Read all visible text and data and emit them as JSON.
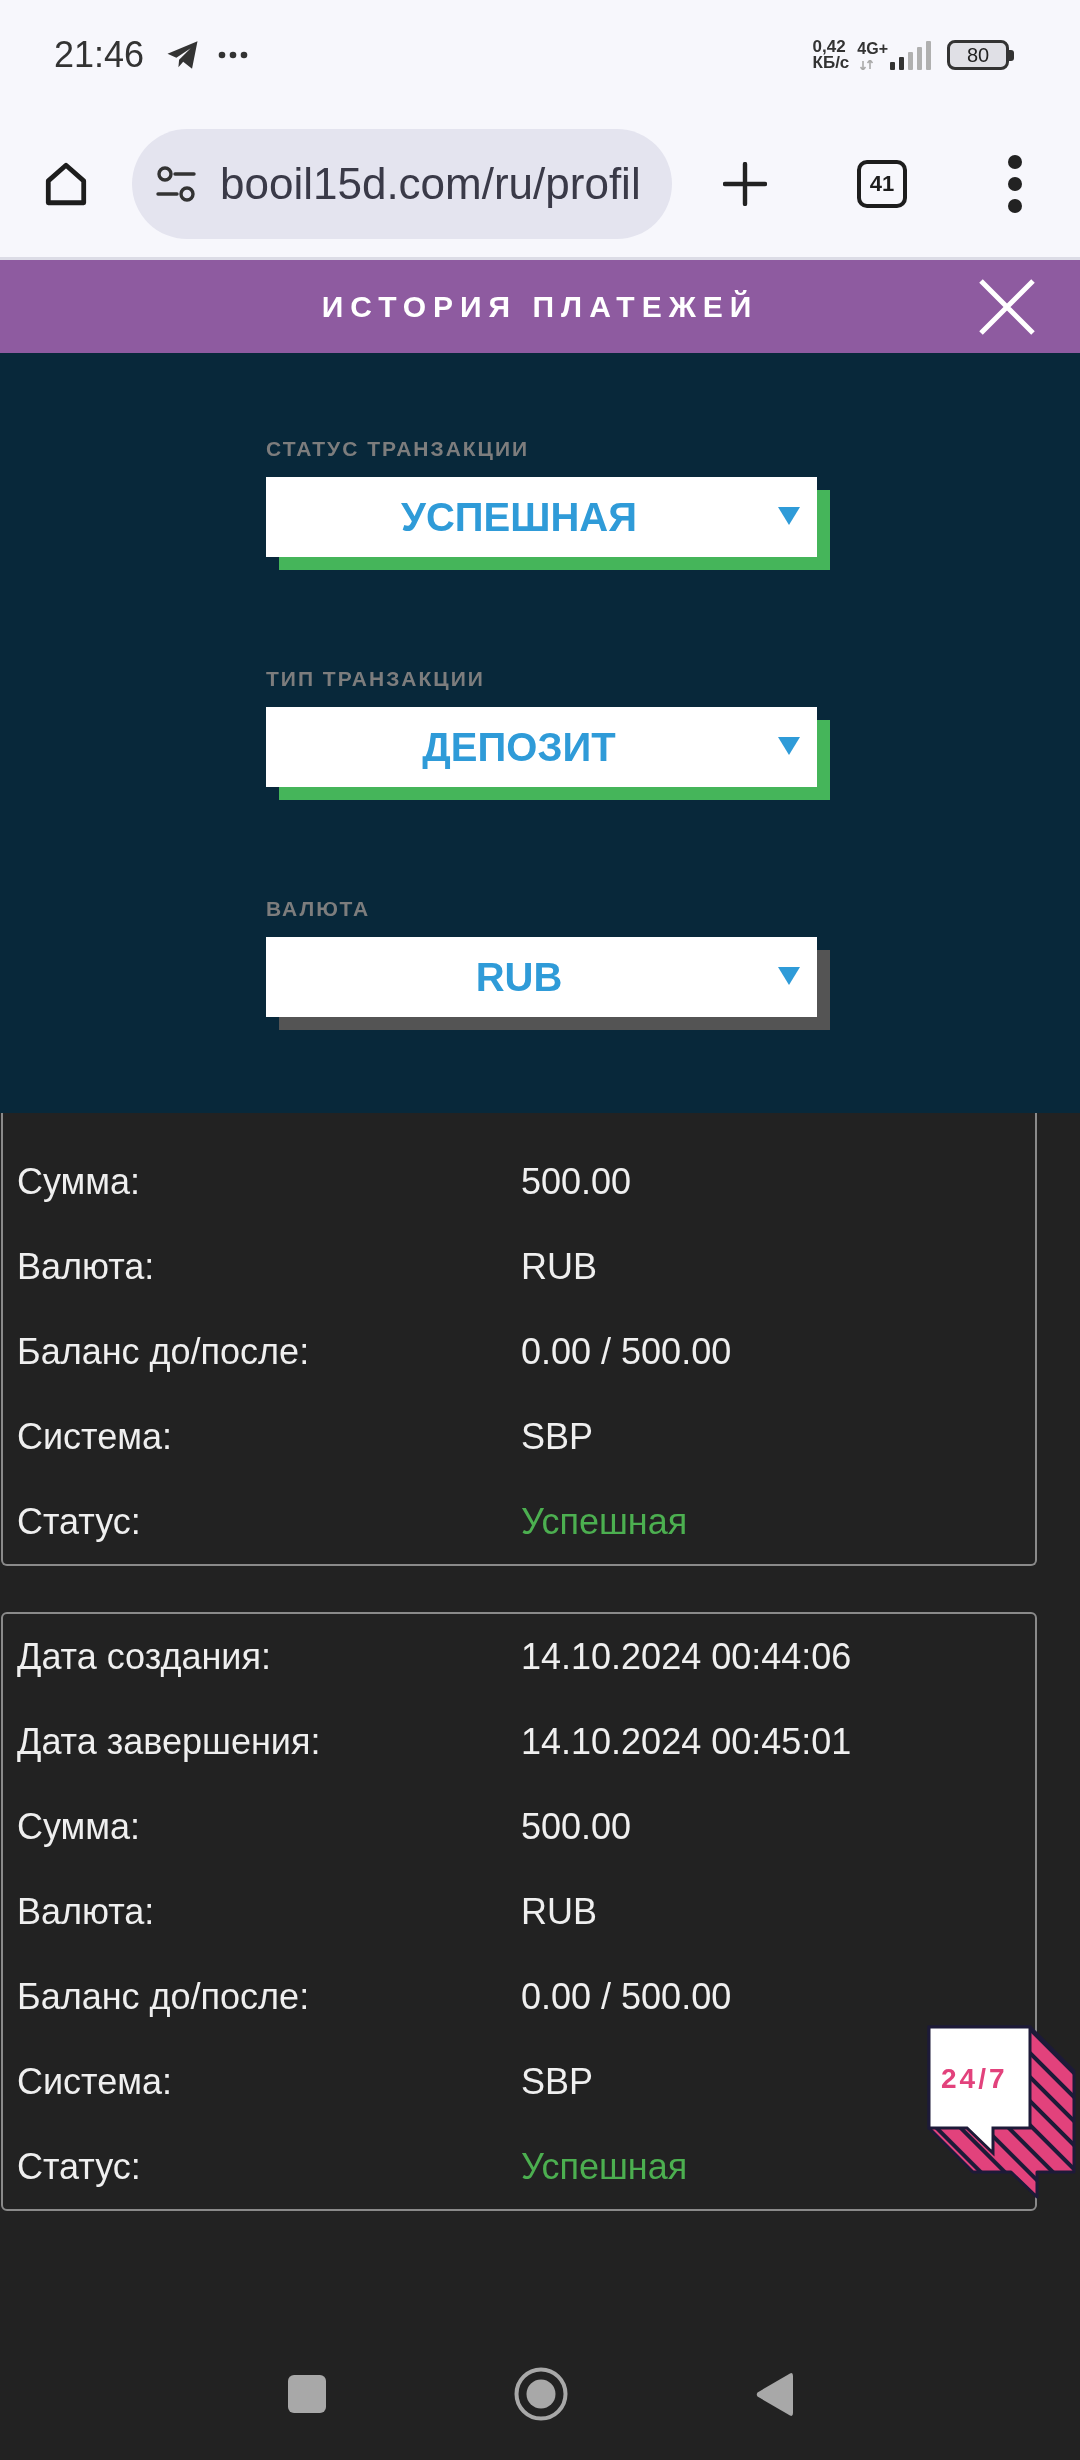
{
  "status_bar": {
    "time": "21:46",
    "speed_value": "0,42",
    "speed_unit": "КБ/с",
    "network_type": "4G+",
    "battery": "80"
  },
  "browser": {
    "url": "booil15d.com/ru/profil",
    "tab_count": "41"
  },
  "modal": {
    "title": "ИСТОРИЯ ПЛАТЕЖЕЙ",
    "filters": [
      {
        "label": "СТАТУС ТРАНЗАКЦИИ",
        "value": "УСПЕШНАЯ",
        "color": "#45b55a"
      },
      {
        "label": "ТИП ТРАНЗАКЦИИ",
        "value": "ДЕПОЗИТ",
        "color": "#45b55a"
      },
      {
        "label": "ВАЛЮТА",
        "value": "RUB",
        "color": "#545454"
      }
    ]
  },
  "transactions": [
    {
      "fields": [
        {
          "label": "Сумма:",
          "value": "500.00"
        },
        {
          "label": "Валюта:",
          "value": "RUB"
        },
        {
          "label": "Баланс до/после:",
          "value": "0.00 / 500.00"
        },
        {
          "label": "Система:",
          "value": "SBP"
        }
      ],
      "status": {
        "label": "Статус:",
        "value": "Успешная"
      }
    },
    {
      "fields": [
        {
          "label": "Дата создания:",
          "value": "14.10.2024 00:44:06"
        },
        {
          "label": "Дата завершения:",
          "value": "14.10.2024 00:45:01"
        },
        {
          "label": "Сумма:",
          "value": "500.00"
        },
        {
          "label": "Валюта:",
          "value": "RUB"
        },
        {
          "label": "Баланс до/после:",
          "value": "0.00 / 500.00"
        },
        {
          "label": "Система:",
          "value": "SBP"
        }
      ],
      "status": {
        "label": "Статус:",
        "value": "Успешная"
      }
    }
  ],
  "support_badge": {
    "text": "24/7"
  }
}
